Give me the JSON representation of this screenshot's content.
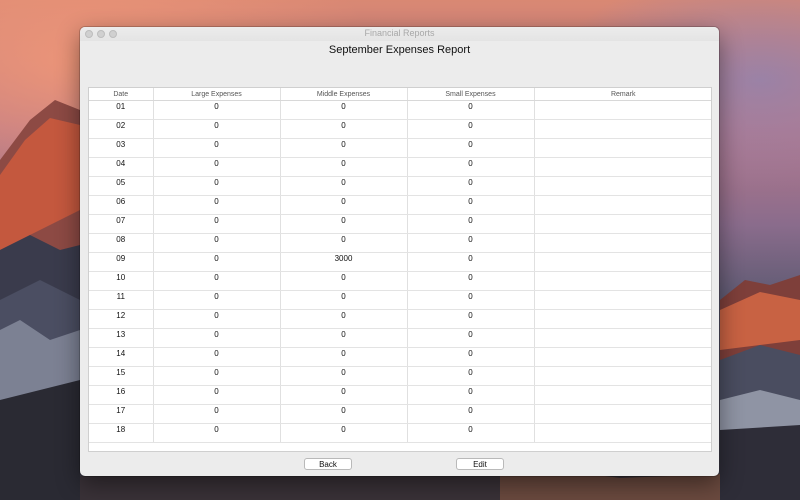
{
  "window": {
    "title": "Financial Reports"
  },
  "report": {
    "title": "September Expenses Report"
  },
  "table": {
    "columns": {
      "date": "Date",
      "large": "Large Expenses",
      "middle": "Middle Expenses",
      "small": "Small Expenses",
      "remark": "Remark"
    },
    "rows": [
      {
        "date": "01",
        "large": "0",
        "middle": "0",
        "small": "0",
        "remark": ""
      },
      {
        "date": "02",
        "large": "0",
        "middle": "0",
        "small": "0",
        "remark": ""
      },
      {
        "date": "03",
        "large": "0",
        "middle": "0",
        "small": "0",
        "remark": ""
      },
      {
        "date": "04",
        "large": "0",
        "middle": "0",
        "small": "0",
        "remark": ""
      },
      {
        "date": "05",
        "large": "0",
        "middle": "0",
        "small": "0",
        "remark": ""
      },
      {
        "date": "06",
        "large": "0",
        "middle": "0",
        "small": "0",
        "remark": ""
      },
      {
        "date": "07",
        "large": "0",
        "middle": "0",
        "small": "0",
        "remark": ""
      },
      {
        "date": "08",
        "large": "0",
        "middle": "0",
        "small": "0",
        "remark": ""
      },
      {
        "date": "09",
        "large": "0",
        "middle": "3000",
        "small": "0",
        "remark": ""
      },
      {
        "date": "10",
        "large": "0",
        "middle": "0",
        "small": "0",
        "remark": ""
      },
      {
        "date": "11",
        "large": "0",
        "middle": "0",
        "small": "0",
        "remark": ""
      },
      {
        "date": "12",
        "large": "0",
        "middle": "0",
        "small": "0",
        "remark": ""
      },
      {
        "date": "13",
        "large": "0",
        "middle": "0",
        "small": "0",
        "remark": ""
      },
      {
        "date": "14",
        "large": "0",
        "middle": "0",
        "small": "0",
        "remark": ""
      },
      {
        "date": "15",
        "large": "0",
        "middle": "0",
        "small": "0",
        "remark": ""
      },
      {
        "date": "16",
        "large": "0",
        "middle": "0",
        "small": "0",
        "remark": ""
      },
      {
        "date": "17",
        "large": "0",
        "middle": "0",
        "small": "0",
        "remark": ""
      },
      {
        "date": "18",
        "large": "0",
        "middle": "0",
        "small": "0",
        "remark": ""
      }
    ]
  },
  "buttons": {
    "back": "Back",
    "edit": "Edit"
  }
}
